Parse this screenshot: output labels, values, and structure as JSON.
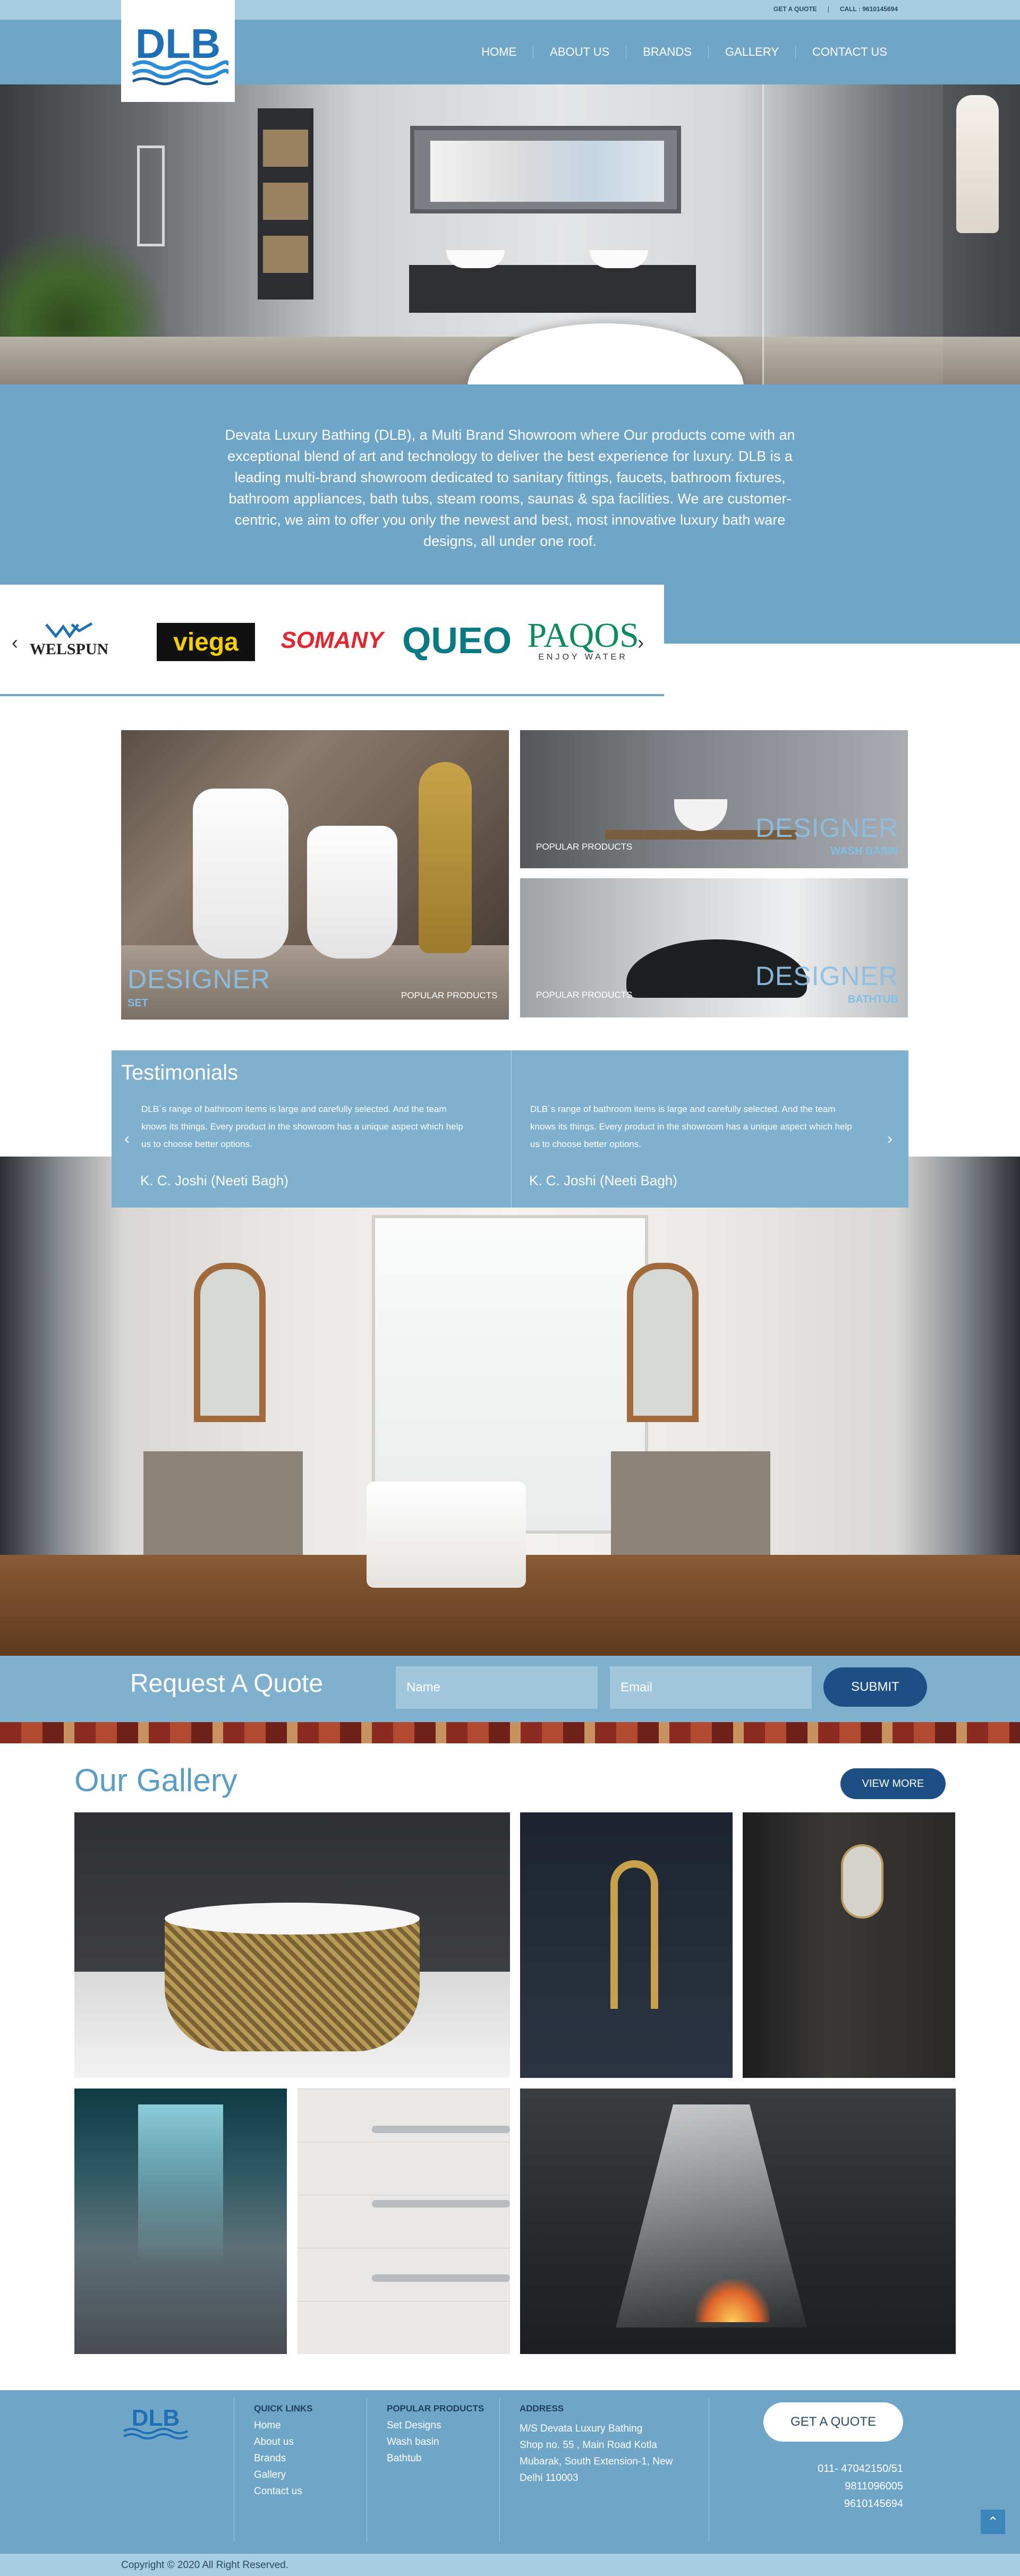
{
  "topbar": {
    "get_quote": "GET A QUOTE",
    "separator": "|",
    "call": "CALL : 9610145694"
  },
  "header": {
    "logo_text": "DLB",
    "nav": [
      "HOME",
      "ABOUT US",
      "BRANDS",
      "GALLERY",
      "CONTACT US"
    ]
  },
  "about": {
    "text": "Devata Luxury Bathing (DLB), a Multi Brand Showroom where Our products come with an exceptional blend of art and technology to deliver the best experience for luxury. DLB is a leading multi-brand showroom dedicated to sanitary fittings, faucets, bathroom fixtures, bathroom appliances, bath tubs, steam rooms, saunas & spa facilities. We are customer-centric, we aim to offer you only the newest and best, most innovative luxury bath ware designs, all under one roof."
  },
  "brands": {
    "prev": "‹",
    "next": "›",
    "items": [
      {
        "name": "WELSPUN"
      },
      {
        "name": "viega"
      },
      {
        "name": "SOMANY"
      },
      {
        "name": "QUEO"
      },
      {
        "name": "PAQOS",
        "tagline": "ENJOY WATER"
      }
    ]
  },
  "products": [
    {
      "category": "POPULAR PRODUCTS",
      "title": "DESIGNER",
      "subtitle": "SET"
    },
    {
      "category": "POPULAR PRODUCTS",
      "title": "DESIGNER",
      "subtitle": "WASH BASIN"
    },
    {
      "category": "POPULAR PRODUCTS",
      "title": "DESIGNER",
      "subtitle": "BATHTUB"
    }
  ],
  "testimonials": {
    "title": "Testimonials",
    "prev": "‹",
    "next": "›",
    "items": [
      {
        "quote": "DLB´s range of bathroom items is large and carefully selected. And the team knows its things. Every product in the showroom has a unique aspect which help us to choose better options.",
        "author": "K. C. Joshi (Neeti Bagh)"
      },
      {
        "quote": "DLB´s range of bathroom items is large and carefully selected. And the team knows its things. Every product in the showroom has a unique aspect which help us to choose better options.",
        "author": "K. C. Joshi (Neeti Bagh)"
      }
    ]
  },
  "quote_form": {
    "title": "Request A Quote",
    "name_placeholder": "Name",
    "email_placeholder": "Email",
    "submit": "SUBMIT"
  },
  "gallery": {
    "title": "Our Gallery",
    "view_more": "VIEW MORE"
  },
  "footer": {
    "quick_links": {
      "heading": "QUICK LINKS",
      "items": [
        "Home",
        "About us",
        "Brands",
        "Gallery",
        "Contact us"
      ]
    },
    "popular_products": {
      "heading": "POPULAR PRODUCTS",
      "items": [
        "Set Designs",
        "Wash basin",
        "Bathtub"
      ]
    },
    "address": {
      "heading": "ADDRESS",
      "lines": [
        "M/S Devata Luxury Bathing",
        "Shop no. 55 , Main Road Kotla",
        "Mubarak, South Extension-1, New",
        "Delhi 110003"
      ]
    },
    "get_quote": "GET A QUOTE",
    "phones": [
      "011- 47042150/51",
      "9811096005",
      "9610145694"
    ],
    "to_top": "⌃"
  },
  "copyright": "Copyright © 2020 All Right Reserved.",
  "colors": {
    "primary": "#6fa6c8",
    "dark_blue": "#1d4f84",
    "light_blue": "#a8cde0"
  }
}
